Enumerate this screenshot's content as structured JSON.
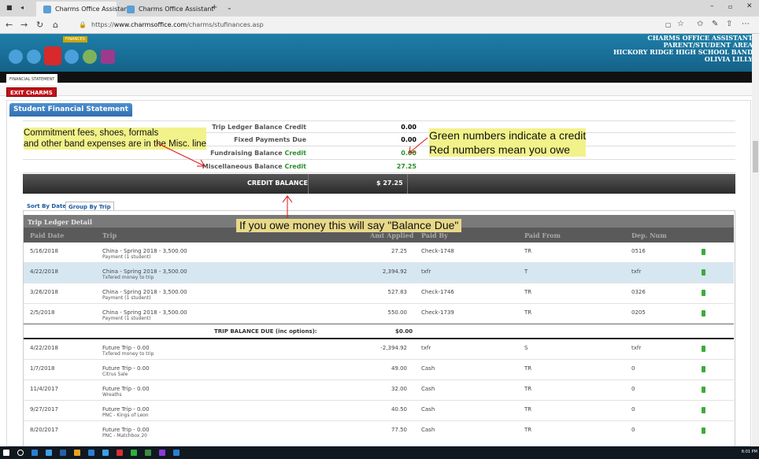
{
  "browser": {
    "tabs": [
      {
        "label": "Charms Office Assistant",
        "active": true
      },
      {
        "label": "Charms Office Assistant",
        "active": false
      }
    ],
    "url_prefix": "https://",
    "url_domain": "www.charmsoffice.com",
    "url_path": "/charms/stufinances.asp"
  },
  "app": {
    "nav_active_label": "FINANCES",
    "header_lines": [
      "CHARMS OFFICE ASSISTANT",
      "PARENT/STUDENT AREA",
      "HICKORY RIDGE HIGH SCHOOL BAND",
      "OLIVIA LILLY"
    ],
    "section_tab": "FINANCIAL STATEMENT",
    "exit_label": "EXIT CHARMS",
    "panel_title": "Student Financial Statement"
  },
  "summary": {
    "rows": [
      {
        "label": "Trip Ledger Balance",
        "suffix": "Credit",
        "value": "0.00",
        "value_color": "#222222"
      },
      {
        "label": "Fixed Payments Due",
        "suffix": "",
        "value": "0.00",
        "value_color": "#222222"
      },
      {
        "label": "Fundraising Balance",
        "suffix": "Credit",
        "value": "0.00",
        "value_color": "#2a8f2a"
      },
      {
        "label": "Miscellaneous Balance",
        "suffix": "Credit",
        "value": "27.25",
        "value_color": "#2a8f2a"
      }
    ],
    "credit_label": "CREDIT BALANCE",
    "credit_value": "$ 27.25"
  },
  "sort_tabs": {
    "by_date": "Sort By Date",
    "by_trip": "Group By Trip"
  },
  "ledger": {
    "title": "Trip Ledger Detail",
    "headers": [
      "Paid Date",
      "Trip",
      "Amt Applied",
      "Paid By",
      "Paid From",
      "Dep. Num"
    ],
    "rows": [
      {
        "date": "5/16/2018",
        "trip": "China - Spring 2018 - 3,500.00",
        "note": "Payment (1 student)",
        "amt": "27.25",
        "paid_by": "Check-1748",
        "paid_from": "TR",
        "dep": "0516"
      },
      {
        "date": "4/22/2018",
        "trip": "China - Spring 2018 - 3,500.00",
        "note": "Txfered money to trip",
        "amt": "2,394.92",
        "paid_by": "txfr",
        "paid_from": "T",
        "dep": "txfr"
      },
      {
        "date": "3/26/2018",
        "trip": "China - Spring 2018 - 3,500.00",
        "note": "Payment (1 student)",
        "amt": "527.83",
        "paid_by": "Check-1746",
        "paid_from": "TR",
        "dep": "0326"
      },
      {
        "date": "2/5/2018",
        "trip": "China - Spring 2018 - 3,500.00",
        "note": "Payment (1 student)",
        "amt": "550.00",
        "paid_by": "Check-1739",
        "paid_from": "TR",
        "dep": "0205"
      },
      {
        "date": "4/22/2018",
        "trip": "Future Trip - 0.00",
        "note": "Txfered money to trip",
        "amt": "-2,394.92",
        "paid_by": "txfr",
        "paid_from": "S",
        "dep": "txfr"
      },
      {
        "date": "1/7/2018",
        "trip": "Future Trip - 0.00",
        "note": "Citrus Sale",
        "amt": "49.00",
        "paid_by": "Cash",
        "paid_from": "TR",
        "dep": "0"
      },
      {
        "date": "11/4/2017",
        "trip": "Future Trip - 0.00",
        "note": "Wreaths",
        "amt": "32.00",
        "paid_by": "Cash",
        "paid_from": "TR",
        "dep": "0"
      },
      {
        "date": "9/27/2017",
        "trip": "Future Trip - 0.00",
        "note": "PNC - Kings of Leon",
        "amt": "40.50",
        "paid_by": "Cash",
        "paid_from": "TR",
        "dep": "0"
      },
      {
        "date": "8/20/2017",
        "trip": "Future Trip - 0.00",
        "note": "PNC - Matchbox 20",
        "amt": "77.50",
        "paid_by": "Cash",
        "paid_from": "TR",
        "dep": "0"
      }
    ],
    "balance_label": "TRIP BALANCE DUE (inc options):",
    "balance_value": "$0.00"
  },
  "annotations": {
    "note1_line1": "Commitment fees, shoes, formals",
    "note1_line2": "and other band expenses are in the Misc. line",
    "note2_line1": "Green numbers indicate a credit",
    "note2_line2": "Red numbers mean you owe",
    "note3": "If you owe money this will say \"Balance Due\""
  },
  "taskbar": {
    "clock": "6:01 PM"
  }
}
